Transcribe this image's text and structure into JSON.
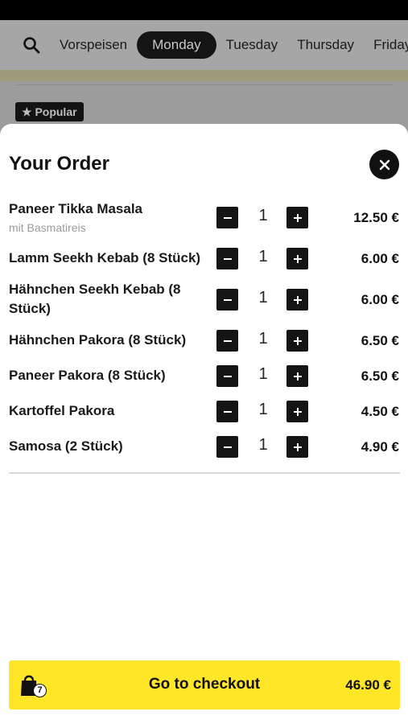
{
  "categories": [
    "Vorspeisen",
    "Monday",
    "Tuesday",
    "Thursday",
    "Friday"
  ],
  "active_category": "Monday",
  "popular_badge": "★ Popular",
  "order": {
    "title": "Your Order",
    "items": [
      {
        "name": "Paneer Tikka Masala",
        "subtitle": "mit Basmatireis",
        "qty": "1",
        "price": "12.50 €"
      },
      {
        "name": "Lamm Seekh Kebab (8 Stück)",
        "qty": "1",
        "price": "6.00 €"
      },
      {
        "name": "Hähnchen Seekh Kebab (8 Stück)",
        "qty": "1",
        "price": "6.00 €"
      },
      {
        "name": "Hähnchen Pakora (8 Stück)",
        "qty": "1",
        "price": "6.50 €"
      },
      {
        "name": "Paneer Pakora (8 Stück)",
        "qty": "1",
        "price": "6.50 €"
      },
      {
        "name": "Kartoffel Pakora",
        "qty": "1",
        "price": "4.50 €"
      },
      {
        "name": "Samosa (2 Stück)",
        "qty": "1",
        "price": "4.90 €"
      }
    ]
  },
  "checkout": {
    "label": "Go to checkout",
    "total": "46.90 €",
    "bag_count": "7"
  },
  "colors": {
    "accent": "#ffe626",
    "dark": "#141414"
  }
}
